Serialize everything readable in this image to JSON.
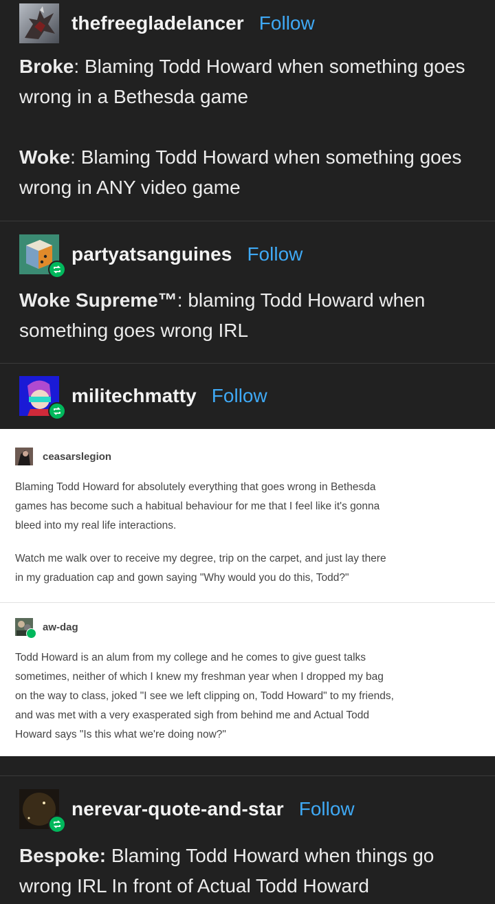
{
  "posts": [
    {
      "username": "thefreegladelancer",
      "follow": "Follow",
      "avatar": "dragon-avatar",
      "paragraphs": [
        {
          "label": "Broke",
          "sep": ": ",
          "text": "Blaming Todd Howard when something goes wrong in a Bethesda game"
        },
        {
          "label": "Woke",
          "sep": ": ",
          "text": "Blaming Todd Howard when something goes wrong in ANY video game"
        }
      ]
    },
    {
      "username": "partyatsanguines",
      "follow": "Follow",
      "avatar": "cube-avatar",
      "paragraphs": [
        {
          "label": "Woke Supreme™",
          "sep": ": ",
          "text": "blaming Todd Howard when something goes wrong IRL"
        }
      ]
    },
    {
      "username": "militechmatty",
      "follow": "Follow",
      "avatar": "character-avatar",
      "paragraphs": []
    },
    {
      "username": "nerevar-quote-and-star",
      "follow": "Follow",
      "avatar": "moon-avatar",
      "paragraphs": [
        {
          "label": "Bespoke:",
          "sep": " ",
          "text": "Blaming Todd Howard when things go wrong IRL In front of Actual Todd Howard"
        }
      ]
    }
  ],
  "embed": {
    "entries": [
      {
        "username": "ceasarslegion",
        "lines": [
          "Blaming Todd Howard for absolutely everything that goes wrong in Bethesda",
          "games has become such a habitual behaviour for me that I feel like it's gonna",
          "bleed into my real life interactions.",
          "",
          "Watch me walk over to receive my degree, trip on the carpet, and just lay there",
          "in my graduation cap and gown saying \"Why would you do this, Todd?\""
        ]
      },
      {
        "username": "aw-dag",
        "lines": [
          "Todd Howard is an alum from my college and he comes to give guest talks",
          "sometimes, neither of which I knew my freshman year when I dropped my bag",
          "on the way to class, joked \"I see we left clipping on, Todd Howard\" to my friends,",
          "and was met with a very exasperated sigh from behind me and Actual Todd",
          "Howard says \"Is this what we're doing now?\""
        ]
      }
    ]
  },
  "colors": {
    "background": "#212121",
    "follow": "#3fa9f5",
    "reblog_badge": "#00b85c"
  }
}
